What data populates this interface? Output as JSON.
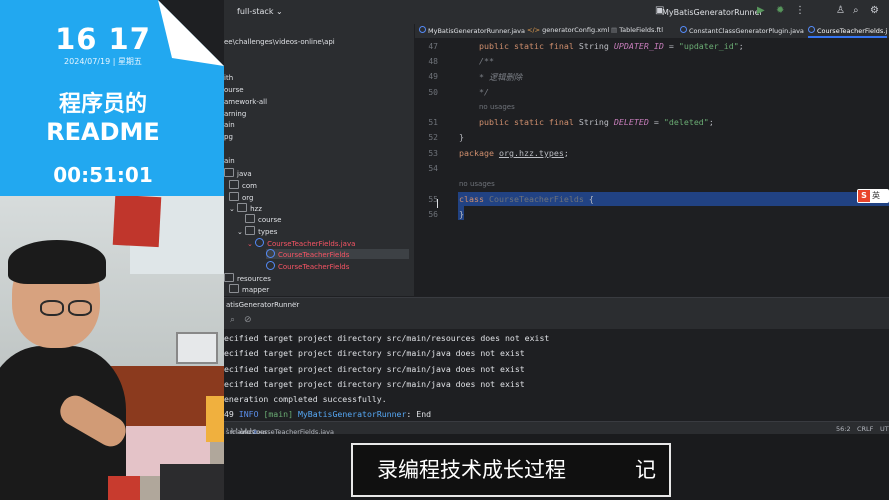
{
  "clock_widget": {
    "time": "16 17",
    "date": "2024/07/19 | 星期五",
    "title_line1": "程序员的",
    "title_line2": "README",
    "timer": "00:51:01"
  },
  "titlebar": {
    "project": "full-stack",
    "run_config": "MyBatisGeneratorRunner"
  },
  "project_tree": {
    "path": "ee\\challenges\\videos-online\\api",
    "items": [
      {
        "label": "ith"
      },
      {
        "label": "ourse"
      },
      {
        "label": "amework-all"
      },
      {
        "label": "arning"
      },
      {
        "label": "ain"
      },
      {
        "label": "pg"
      },
      {
        "label": "ain"
      },
      {
        "label": "java"
      },
      {
        "label": "com"
      },
      {
        "label": "org"
      },
      {
        "label": "hzz"
      },
      {
        "label": "course"
      },
      {
        "label": "types"
      },
      {
        "label": "CourseTeacherFields.java"
      },
      {
        "label": "CourseTeacherFields"
      },
      {
        "label": "CourseTeacherFields"
      },
      {
        "label": "resources"
      },
      {
        "label": "mapper"
      }
    ]
  },
  "tabs": [
    {
      "label": "MyBatisGeneratorRunner.java"
    },
    {
      "label": "generatorConfig.xml"
    },
    {
      "label": "TableFields.ftl"
    },
    {
      "label": "ConstantClassGeneratorPlugin.java"
    },
    {
      "label": "CourseTeacherFields.j"
    }
  ],
  "editor": {
    "line_numbers": [
      "47",
      "48",
      "50",
      "51",
      "52",
      "53",
      "54",
      "55",
      "56"
    ],
    "line49": "49",
    "l47": {
      "mod": "public static final ",
      "type": "String ",
      "name": "UPDATER_ID",
      "eq": " = ",
      "val": "\"updater_id\"",
      "end": ";"
    },
    "l48": "/**",
    "l49": "* 逻辑删除",
    "l50": "*/",
    "usages1": "no usages",
    "l51": {
      "mod": "public static final ",
      "type": "String ",
      "name": "DELETED",
      "eq": " = ",
      "val": "\"deleted\"",
      "end": ";"
    },
    "l52": "}",
    "l53": {
      "kw": "package ",
      "pkg": "org.hzz.types",
      "end": ";"
    },
    "usages2": "no usages",
    "l55": {
      "kw": "class ",
      "name": "CourseTeacherFields",
      "rest": " {"
    },
    "l56": "}",
    "ime_label": "英"
  },
  "run_panel": {
    "title": "atisGeneratorRunner",
    "lines": [
      "ecified target project directory src/main/resources does not exist",
      "ecified target project directory src/main/java does not exist",
      "ecified target project directory src/main/java does not exist",
      "ecified target project directory src/main/java does not exist",
      "eneration completed successfully."
    ],
    "last_line": {
      "num": "49",
      "level": " INFO ",
      "thread": "[main] ",
      "cls": "MyBatisGeneratorRunner",
      "msg": ": End"
    }
  },
  "statusbar": {
    "breadcrumb": [
      "src",
      "main",
      "java",
      "org",
      "hzz",
      "types",
      "CourseTeacherFields.java"
    ],
    "position": "56:2",
    "line_sep": "CRLF",
    "encoding": "UTF"
  },
  "caption": {
    "text": "录编程技术成长过程",
    "tail": "记"
  }
}
